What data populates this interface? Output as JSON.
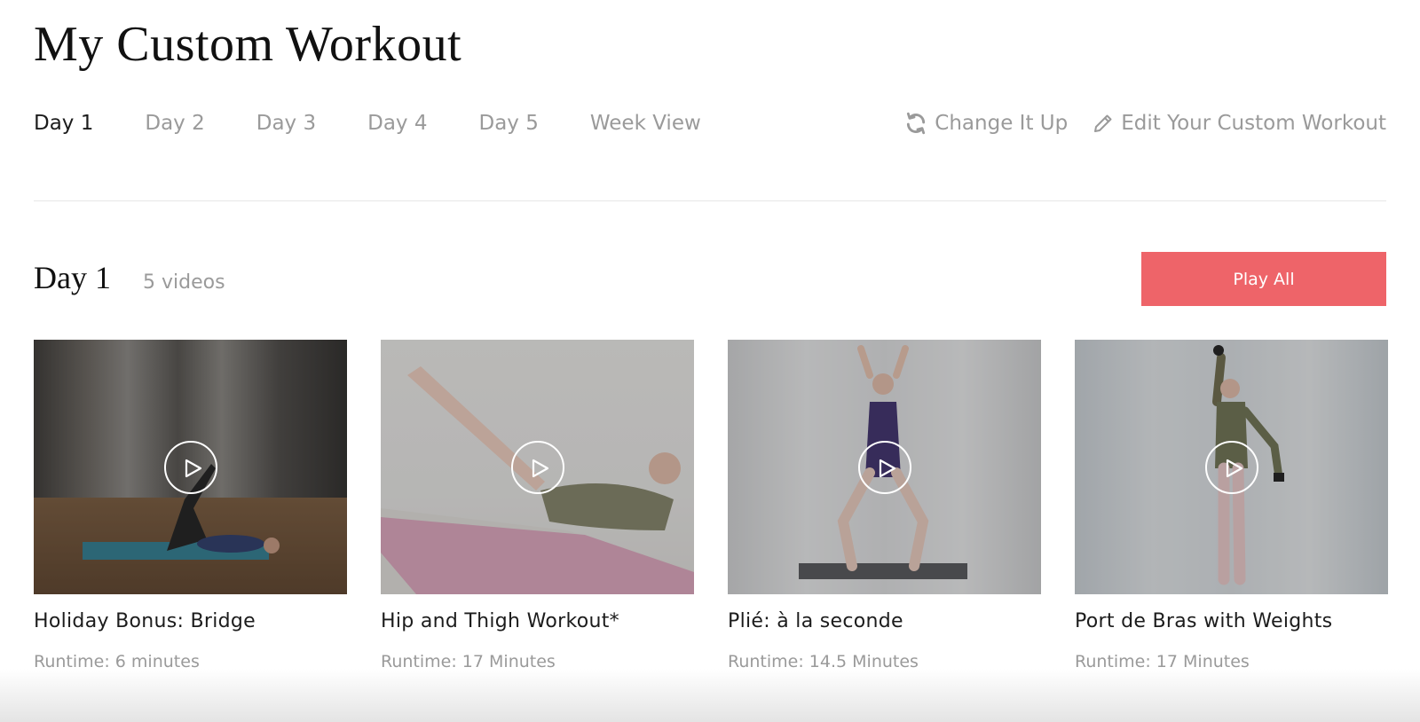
{
  "page": {
    "title": "My Custom Workout"
  },
  "tabs": [
    {
      "label": "Day 1",
      "active": true
    },
    {
      "label": "Day 2",
      "active": false
    },
    {
      "label": "Day 3",
      "active": false
    },
    {
      "label": "Day 4",
      "active": false
    },
    {
      "label": "Day 5",
      "active": false
    },
    {
      "label": "Week View",
      "active": false
    }
  ],
  "actions": {
    "change_label": "Change It Up",
    "change_icon": "refresh-icon",
    "edit_label": "Edit Your Custom Workout",
    "edit_icon": "pencil-icon"
  },
  "section": {
    "title": "Day 1",
    "count": "5 videos",
    "play_all_label": "Play All"
  },
  "videos": [
    {
      "title": "Holiday Bonus: Bridge",
      "runtime": "Runtime: 6 minutes"
    },
    {
      "title": "Hip and Thigh Workout*",
      "runtime": "Runtime: 17 Minutes"
    },
    {
      "title": "Plié: à la seconde",
      "runtime": "Runtime: 14.5 Minutes"
    },
    {
      "title": "Port de Bras with Weights",
      "runtime": "Runtime: 17 Minutes"
    }
  ],
  "colors": {
    "accent": "#ee6469",
    "muted_text": "#9a9a9a",
    "active_text": "#1c1c1c"
  }
}
